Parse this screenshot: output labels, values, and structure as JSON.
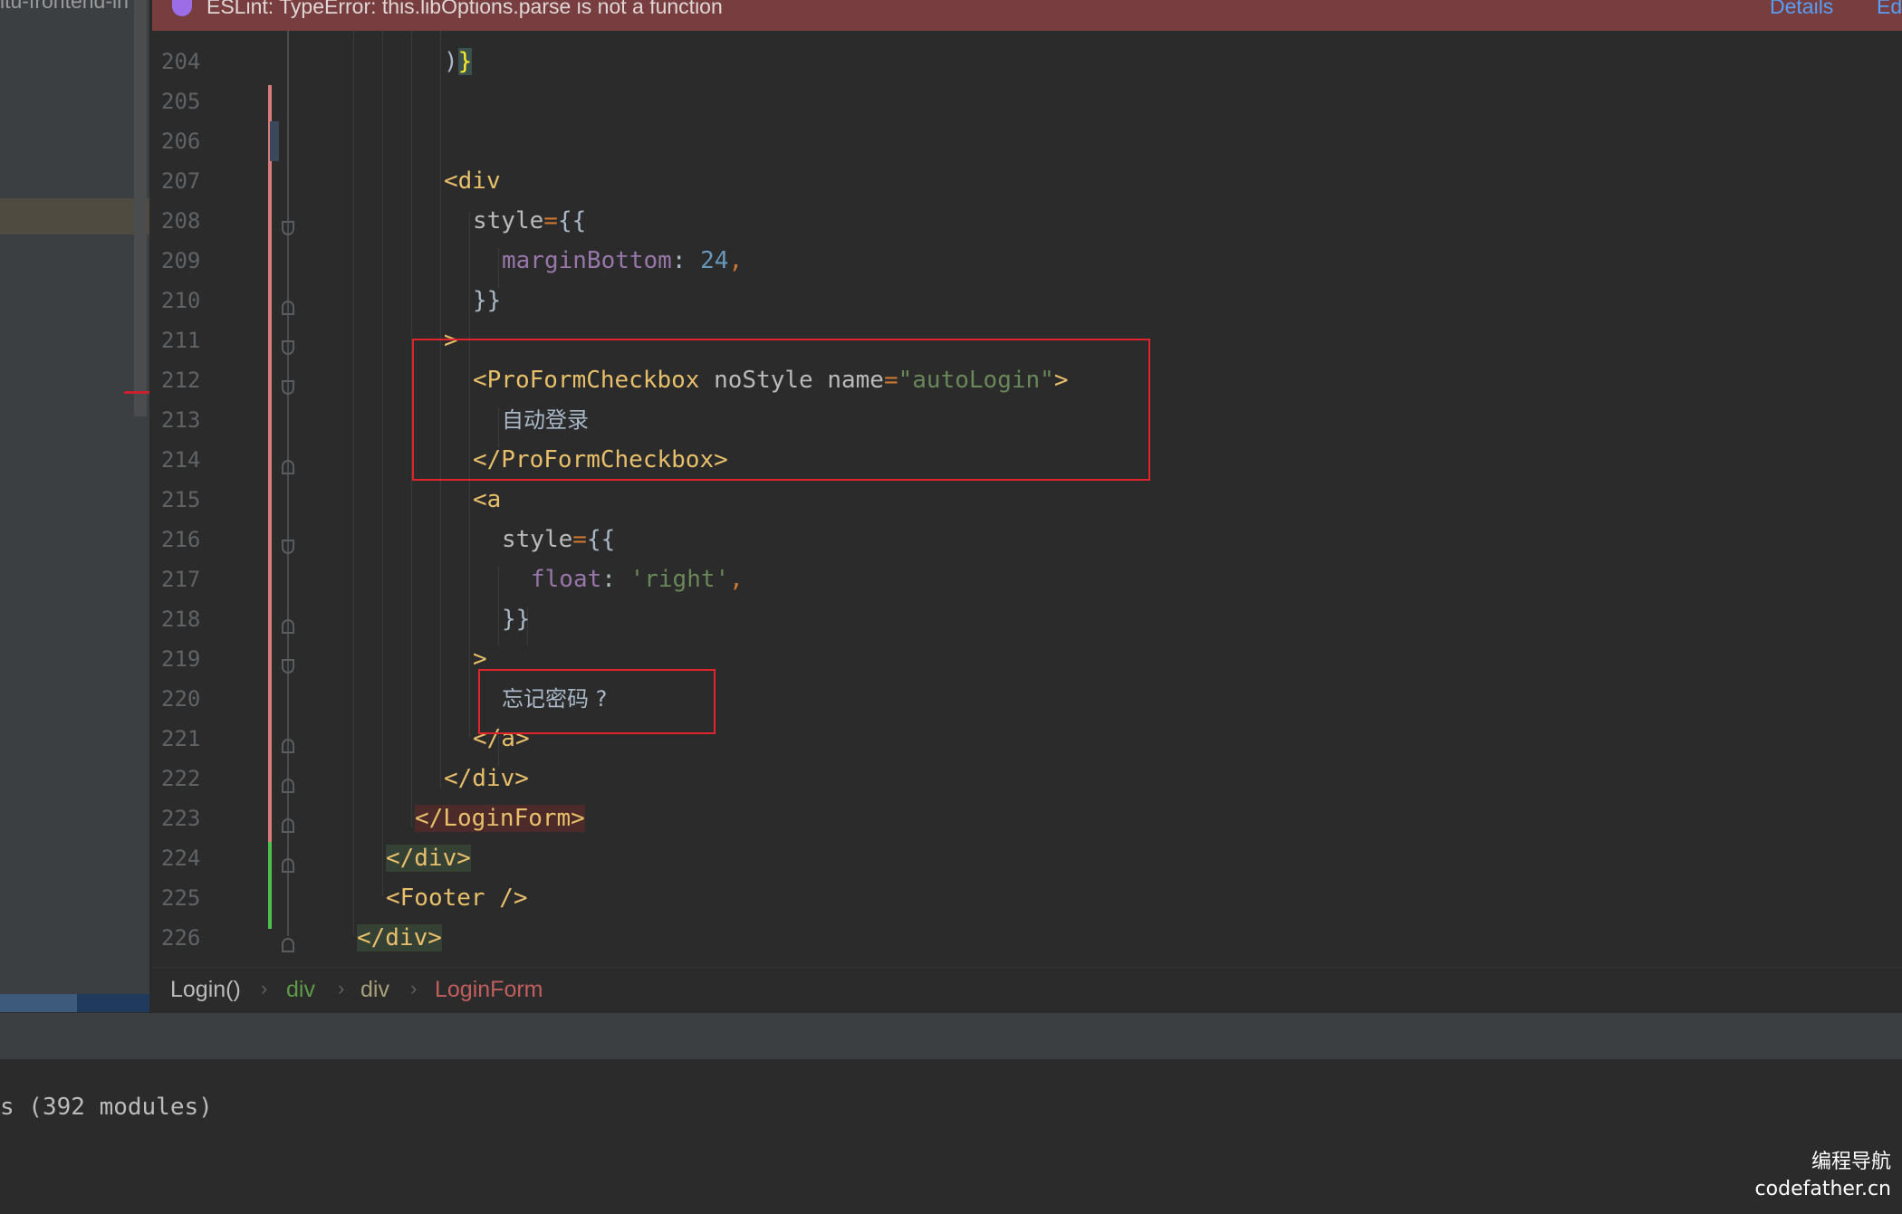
{
  "project_panel": {
    "truncated_label": "itu-frontend-in"
  },
  "banner": {
    "message": "ESLint: TypeError: this.libOptions.parse is not a function",
    "details_link": "Details",
    "edit_link": "Ed"
  },
  "editor": {
    "line_numbers": [
      "204",
      "205",
      "206",
      "207",
      "208",
      "209",
      "210",
      "211",
      "212",
      "213",
      "214",
      "215",
      "216",
      "217",
      "218",
      "219",
      "220",
      "221",
      "222",
      "223",
      "224",
      "225",
      "226"
    ],
    "lines": {
      "l204_paren": ")",
      "l204_brace": "}",
      "l207_open": "<div",
      "l208_attr": "style",
      "l208_eq": "=",
      "l208_braces": "{{",
      "l209_prop": "marginBottom",
      "l209_colon": ": ",
      "l209_num": "24",
      "l209_comma": ",",
      "l210_close": "}}",
      "l211_gt": ">",
      "l212_tag_open": "<ProFormCheckbox",
      "l212_attr1": " noStyle ",
      "l212_attr2": "name",
      "l212_eq": "=",
      "l212_str": "\"autoLogin\"",
      "l212_gt": ">",
      "l213_text": "自动登录",
      "l214_tag_close": "</ProFormCheckbox>",
      "l215_open": "<a",
      "l216_attr": "style",
      "l216_eq": "=",
      "l216_braces": "{{",
      "l217_prop": "float",
      "l217_colon": ": ",
      "l217_str": "'right'",
      "l217_comma": ",",
      "l218_close": "}}",
      "l219_gt": ">",
      "l220_text": "忘记密码 ?",
      "l221_close": "</a>",
      "l222_close": "</div>",
      "l223_close": "</LoginForm>",
      "l224_close": "</div>",
      "l225_footer": "<Footer />",
      "l226_close": "</div>"
    }
  },
  "breadcrumb": {
    "items": [
      "Login()",
      "div",
      "div",
      "LoginForm"
    ],
    "separator": "›"
  },
  "terminal": {
    "output": "s (392 modules)"
  },
  "watermark": {
    "line1": "编程导航",
    "line2": "codefather.cn"
  },
  "colors": {
    "banner_bg": "#783e3f",
    "editor_bg": "#2b2b2b",
    "tag": "#e8bf6a",
    "string": "#6a8759",
    "property": "#9876aa",
    "number": "#6897bb",
    "annotation_box": "#e0242b"
  }
}
